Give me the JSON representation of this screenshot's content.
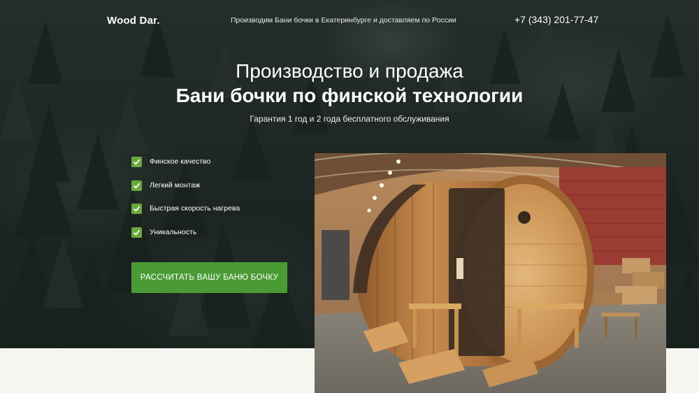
{
  "header": {
    "logo": "Wood Dar.",
    "tagline": "Производим Бани бочки в Екатеринбурге и доставляем по России",
    "phone": "+7 (343) 201-77-47"
  },
  "hero": {
    "title_line1": "Производство и продажа",
    "title_line2": "Бани бочки по финской технологии",
    "subtitle": "Гарантия 1 год и 2 года бесплатного обслуживания"
  },
  "features": [
    {
      "label": "Финское качество",
      "icon": "check-icon"
    },
    {
      "label": "Легкий монтаж",
      "icon": "check-icon"
    },
    {
      "label": "Быстрая скорость нагрева",
      "icon": "check-icon"
    },
    {
      "label": "Уникальность",
      "icon": "check-icon"
    }
  ],
  "cta": {
    "label": "РАССЧИТАТЬ ВАШУ БАНЮ БОЧКУ"
  },
  "colors": {
    "accent": "#4a9b35",
    "check": "#6aa83e",
    "forest": "#242d2b",
    "page_bg": "#f6f6f1"
  }
}
